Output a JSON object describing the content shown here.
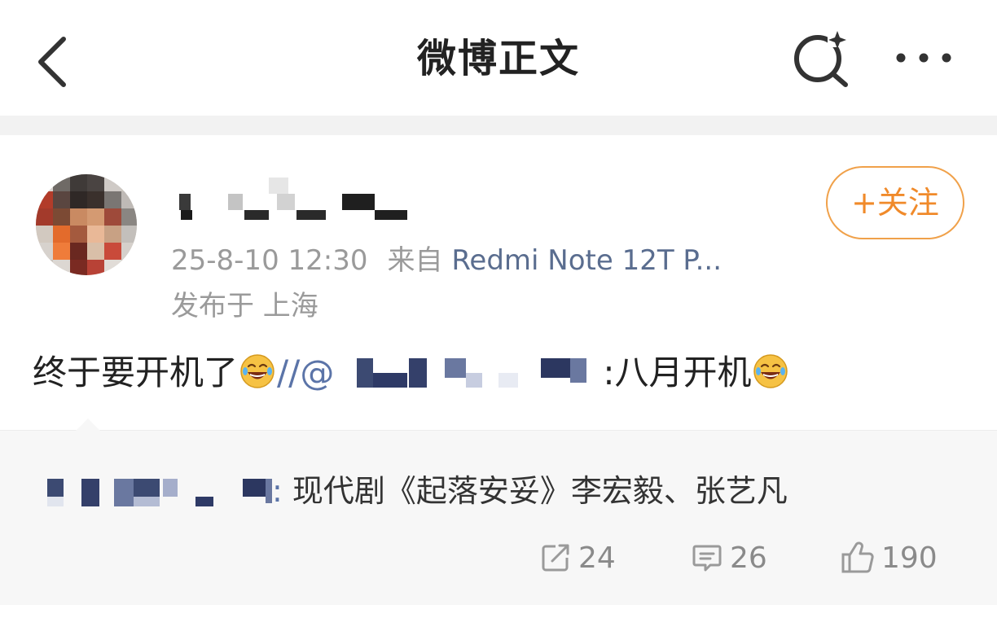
{
  "navbar": {
    "title": "微博正文",
    "back_icon": "chevron-left-icon",
    "search_icon": "search-sparkle-icon",
    "more_icon": "more-dots-icon"
  },
  "post": {
    "timestamp": "25-8-10 12:30",
    "source_prefix": "来自",
    "device": "Redmi Note 12T P...",
    "location": "发布于 上海",
    "follow_label": "+关注",
    "body_start": "终于要开机了",
    "body_sep": "//@",
    "body_mention_tail": ":八月开机",
    "quote": {
      "author_tail": ":",
      "text": " 现代剧《起落安妥》李宏毅、张艺凡"
    },
    "actions": {
      "repost_count": "24",
      "comment_count": "26",
      "like_count": "190"
    }
  },
  "colors": {
    "accent_orange": "#f08a2a",
    "link_blue": "#5b74a8",
    "gray_text": "#9a9a9a"
  }
}
